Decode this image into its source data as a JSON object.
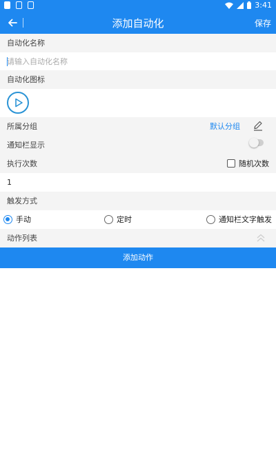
{
  "status_bar": {
    "time": "3:41",
    "icons": [
      "notification-icon",
      "notification-icon",
      "notification-icon",
      "wifi-icon",
      "signal-icon",
      "battery-icon"
    ]
  },
  "app_bar": {
    "title": "添加自动化",
    "save_label": "保存",
    "color": "#1e88f0"
  },
  "name_section": {
    "label": "自动化名称",
    "placeholder": "请输入自动化名称",
    "value": ""
  },
  "icon_section": {
    "label": "自动化图标",
    "icon": "play-icon"
  },
  "group": {
    "label": "所属分组",
    "value": "默认分组"
  },
  "notification": {
    "label": "通知栏显示",
    "enabled": false
  },
  "execution": {
    "label": "执行次数",
    "random_label": "随机次数",
    "random_checked": false,
    "count": "1"
  },
  "trigger": {
    "label": "触发方式",
    "options": [
      "手动",
      "定时",
      "通知栏文字触发"
    ],
    "selected": "手动"
  },
  "actions": {
    "label": "动作列表",
    "add_label": "添加动作"
  }
}
